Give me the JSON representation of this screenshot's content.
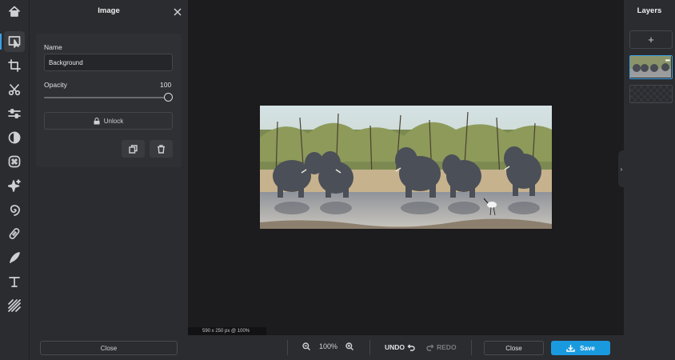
{
  "panel": {
    "title": "Image",
    "name_label": "Name",
    "name_value": "Background",
    "opacity_label": "Opacity",
    "opacity_value": "100",
    "opacity_level": 1.0,
    "unlock_label": "Unlock"
  },
  "canvas": {
    "dimensions": "590 x 250 px @ 100%"
  },
  "layers": {
    "title": "Layers",
    "add_label": "+"
  },
  "bottombar": {
    "close_left": "Close",
    "zoom_level": "100%",
    "undo_label": "UNDO",
    "redo_label": "REDO",
    "close_right": "Close",
    "save_label": "Save"
  },
  "tools": [
    "home-icon",
    "arrange-icon",
    "crop-icon",
    "cut-icon",
    "adjust-icon",
    "filter-icon",
    "effects-icon",
    "ai-sparkle-icon",
    "liquify-icon",
    "retouch-icon",
    "draw-icon",
    "text-icon",
    "pattern-icon"
  ],
  "colors": {
    "accent": "#1a9ade",
    "selection": "#3aa0e6",
    "panel_bg": "#2b2c2f",
    "canvas_bg": "#1c1c1e"
  }
}
